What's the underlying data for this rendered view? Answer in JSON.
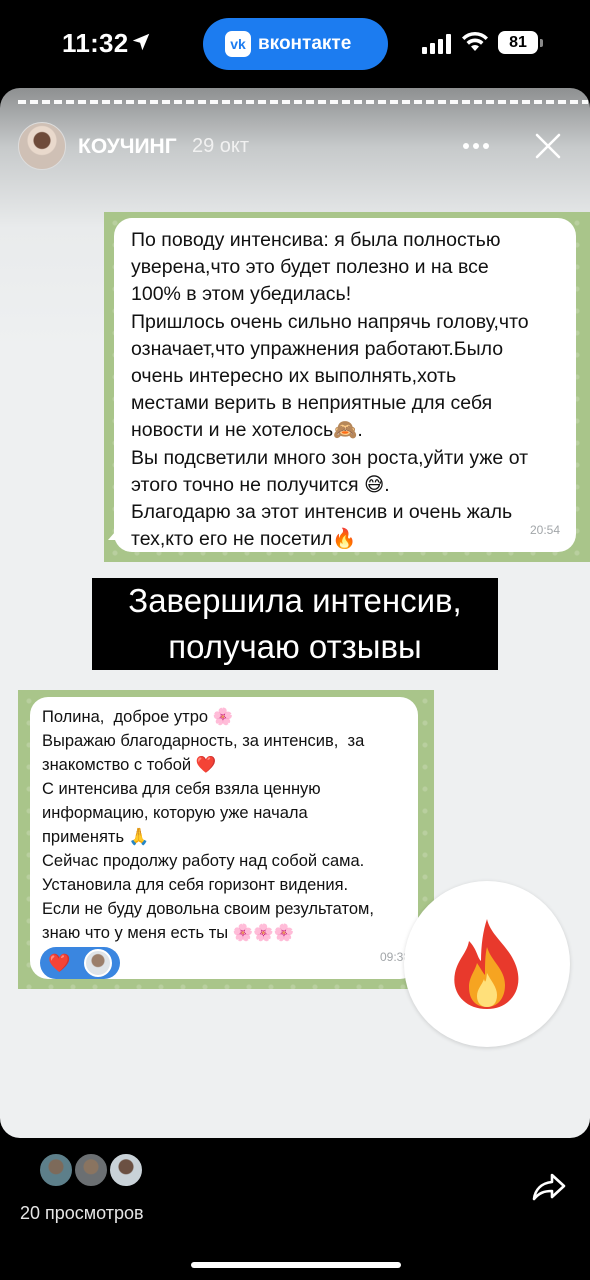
{
  "status_bar": {
    "time": "11:32",
    "app_name": "вконтакте",
    "app_logo": "vk",
    "battery": "81",
    "icons": [
      "location-arrow-icon",
      "signal-icon",
      "wifi-icon",
      "battery-icon"
    ]
  },
  "story": {
    "author": "КОУЧИНГ",
    "date": "29 окт",
    "message1": {
      "text": "По поводу интенсива: я была полностью\nуверена,что это будет полезно и на все\n100% в этом убедилась!\nПришлось очень сильно напрячь голову,что\nозначает,что упражнения работают.Было\nочень интересно их выполнять,хоть\nместами верить в неприятные для себя\nновости и не хотелось🙈.\nВы подсветили много зон роста,уйти уже от\nэтого точно не получится 😅.\nБлагодарю за этот интенсив и очень жаль\nтех,кто его не посетил🔥",
      "time": "20:54"
    },
    "caption": {
      "line1": "Завершила интенсив,",
      "line2": "получаю отзывы"
    },
    "message2": {
      "text": "Полина,  доброе утро 🌸\nВыражаю благодарность, за интенсив,  за\nзнакомство с тобой ❤️\nС интенсива для себя взяла ценную\nинформацию, которую уже начала\nприменять 🙏\nСейчас продолжу работу над собой сама.\nУстановила для себя горизонт видения.\nЕсли не буду довольна своим результатом,\nзнаю что у меня есть ты 🌸🌸🌸",
      "time": "09:38",
      "reaction": "❤️"
    },
    "sticker": "fire-icon"
  },
  "footer": {
    "views": "20 просмотров",
    "share": "share-icon"
  },
  "colors": {
    "vk_blue": "#1c7cf0",
    "chat_green": "#a9c58a",
    "background": "#000000"
  }
}
